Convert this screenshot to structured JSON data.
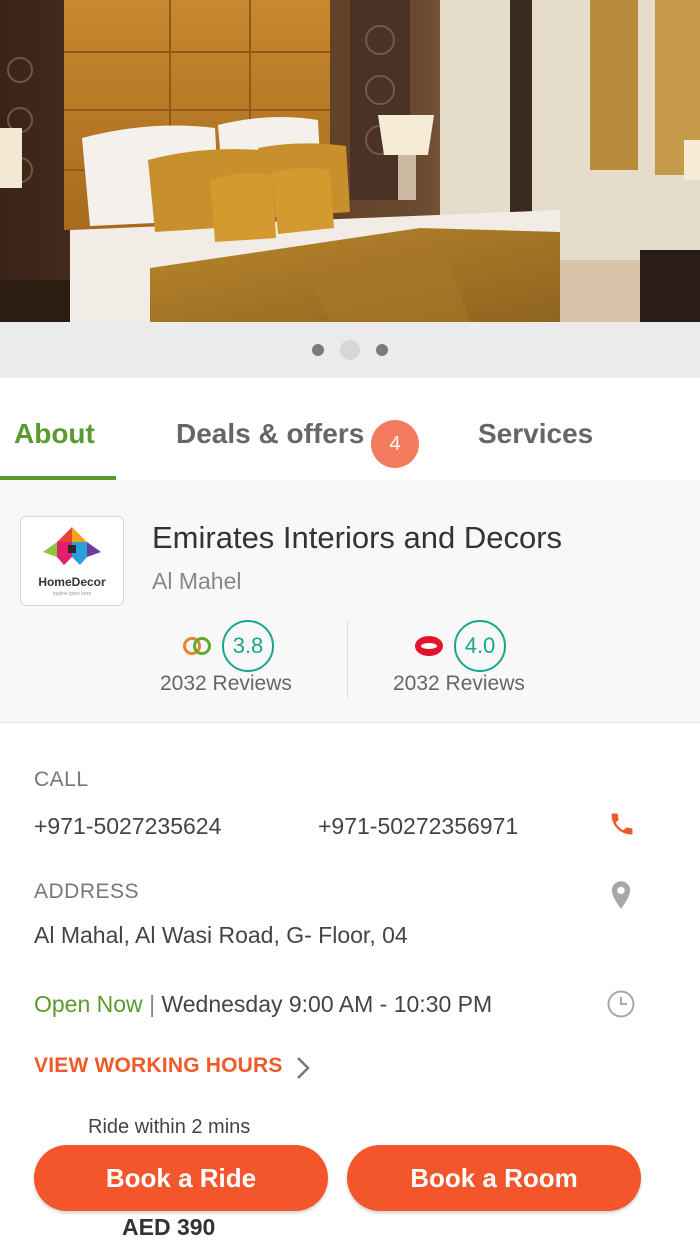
{
  "gallery": {
    "image": "hotel-bedroom-photo",
    "slides": 3,
    "active_slide": 2
  },
  "tabs": {
    "about": "About",
    "deals": "Deals & offers",
    "deals_count": "4",
    "services": "Services"
  },
  "business": {
    "logo_text": "HomeDecor",
    "logo_tagline": "tagline goes here",
    "name": "Emirates Interiors and Decors",
    "area": "Al Mahel",
    "ratings": [
      {
        "source_icon": "rings-logo-icon",
        "score": "3.8",
        "reviews": "2032 Reviews"
      },
      {
        "source_icon": "lips-logo-icon",
        "score": "4.0",
        "reviews": "2032 Reviews"
      }
    ]
  },
  "contact": {
    "call_label": "CALL",
    "phone_1": "+971-5027235624",
    "phone_2": "+971-50272356971",
    "address_label": "ADDRESS",
    "address": "Al Mahal, Al Wasi Road, G- Floor, 04",
    "open_status": "Open Now",
    "separator": "|",
    "hours": "Wednesday 9:00 AM - 10:30 PM",
    "view_hours": "VIEW WORKING HOURS"
  },
  "actions": {
    "ride_note": "Ride within 2 mins",
    "book_ride": "Book a Ride",
    "book_room": "Book a Room",
    "price": "AED 390"
  },
  "colors": {
    "accent_green": "#5a9a2e",
    "accent_orange": "#f4562c",
    "badge": "#f57b5e",
    "rating_teal": "#19a78c"
  }
}
